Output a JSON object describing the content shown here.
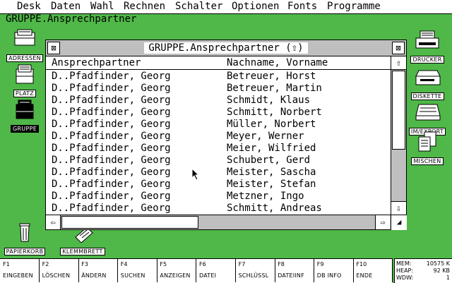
{
  "menu": [
    "Desk",
    "Daten",
    "Wahl",
    "Rechnen",
    "Schalter",
    "Optionen",
    "Fonts",
    "Programme"
  ],
  "subtitle": "GRUPPE.Ansprechpartner",
  "desktop_icons": {
    "adressen": "ADRESSEN",
    "platz": "PLATZ",
    "gruppe": "GRUPPE",
    "drucker": "DRUCKER",
    "diskette": "DISKETTE",
    "imexport": "IM/EXPORT",
    "mischen": "MISCHEN",
    "papierkorb": "PAPIERKORB",
    "klemmbrett": "KLEMMBRETT"
  },
  "window": {
    "title": "GRUPPE.Ansprechpartner (⇧)",
    "close_glyph": "⊠",
    "full_glyph": "⊠",
    "columns": [
      "Ansprechpartner",
      "Nachname, Vorname"
    ],
    "rows": [
      [
        "D..Pfadfinder, Georg",
        "Betreuer, Horst"
      ],
      [
        "D..Pfadfinder, Georg",
        "Betreuer, Martin"
      ],
      [
        "D..Pfadfinder, Georg",
        "Schmidt, Klaus"
      ],
      [
        "D..Pfadfinder, Georg",
        "Schmitt, Norbert"
      ],
      [
        "D..Pfadfinder, Georg",
        "Müller, Norbert"
      ],
      [
        "D..Pfadfinder, Georg",
        "Meyer, Werner"
      ],
      [
        "D..Pfadfinder, Georg",
        "Meier, Wilfried"
      ],
      [
        "D..Pfadfinder, Georg",
        "Schubert, Gerd"
      ],
      [
        "D..Pfadfinder, Georg",
        "Meister, Sascha"
      ],
      [
        "D..Pfadfinder, Georg",
        "Meister, Stefan"
      ],
      [
        "D..Pfadfinder, Georg",
        "Metzner, Ingo"
      ],
      [
        "D..Pfadfinder, Georg",
        "Schmitt, Andreas"
      ]
    ],
    "scroll_up": "⇧",
    "scroll_down": "⇩",
    "scroll_left": "⇦",
    "scroll_right": "⇨",
    "resize_glyph": "◢"
  },
  "function_keys": [
    {
      "key": "F1",
      "label": "EINGEBEN"
    },
    {
      "key": "F2",
      "label": "LÖSCHEN"
    },
    {
      "key": "F3",
      "label": "ÄNDERN"
    },
    {
      "key": "F4",
      "label": "SUCHEN"
    },
    {
      "key": "F5",
      "label": "ANZEIGEN"
    },
    {
      "key": "F6",
      "label": "DATEI"
    },
    {
      "key": "F7",
      "label": "SCHLÜSSL"
    },
    {
      "key": "F8",
      "label": "DATEIINF"
    },
    {
      "key": "F9",
      "label": "DB INFO"
    },
    {
      "key": "F10",
      "label": "ENDE"
    }
  ],
  "memory": {
    "mem_label": "MEM:",
    "mem_value": "10575 K",
    "heap_label": "HEAP:",
    "heap_value": "92 KB",
    "wdw_label": "WDW:",
    "wdw_value": "1"
  },
  "colors": {
    "desktop": "#4fb848",
    "titlebar": "#bfbfbf"
  }
}
